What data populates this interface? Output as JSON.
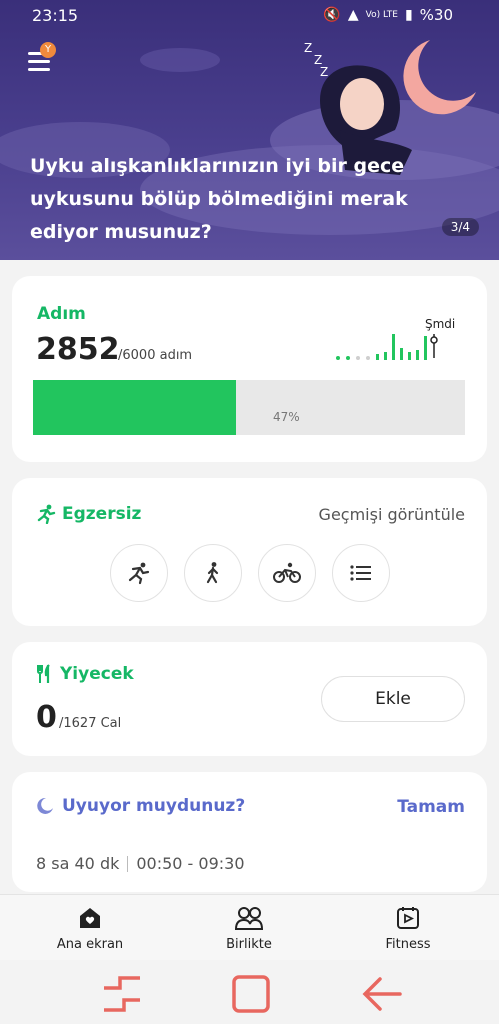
{
  "status_bar": {
    "time": "23:15",
    "network": "Vo) LTE",
    "battery": "%30"
  },
  "banner": {
    "badge": "Y",
    "text": "Uyku alışkanlıklarınızın iyi bir gece uykusunu bölüp bölmediğini merak ediyor musunuz?",
    "pager": "3/4"
  },
  "steps": {
    "title": "Adım",
    "value": "2852",
    "goal": "/6000 adım",
    "now_label": "Şmdi",
    "percent_label": "47%",
    "progress": 0.47,
    "accent": "#15b765"
  },
  "exercise": {
    "title": "Egzersiz",
    "history_label": "Geçmişi görüntüle",
    "buttons": [
      "running-icon",
      "walking-icon",
      "cycling-icon",
      "list-icon"
    ]
  },
  "food": {
    "title": "Yiyecek",
    "value": "0",
    "goal": "/1627 Cal",
    "add_label": "Ekle"
  },
  "sleep": {
    "title": "Uyuyor muydunuz?",
    "ok_label": "Tamam",
    "duration": "8 sa 40 dk",
    "range": "00:50 - 09:30",
    "accent": "#5a6acb"
  },
  "nav": {
    "home": "Ana ekran",
    "together": "Birlikte",
    "fitness": "Fitness"
  }
}
